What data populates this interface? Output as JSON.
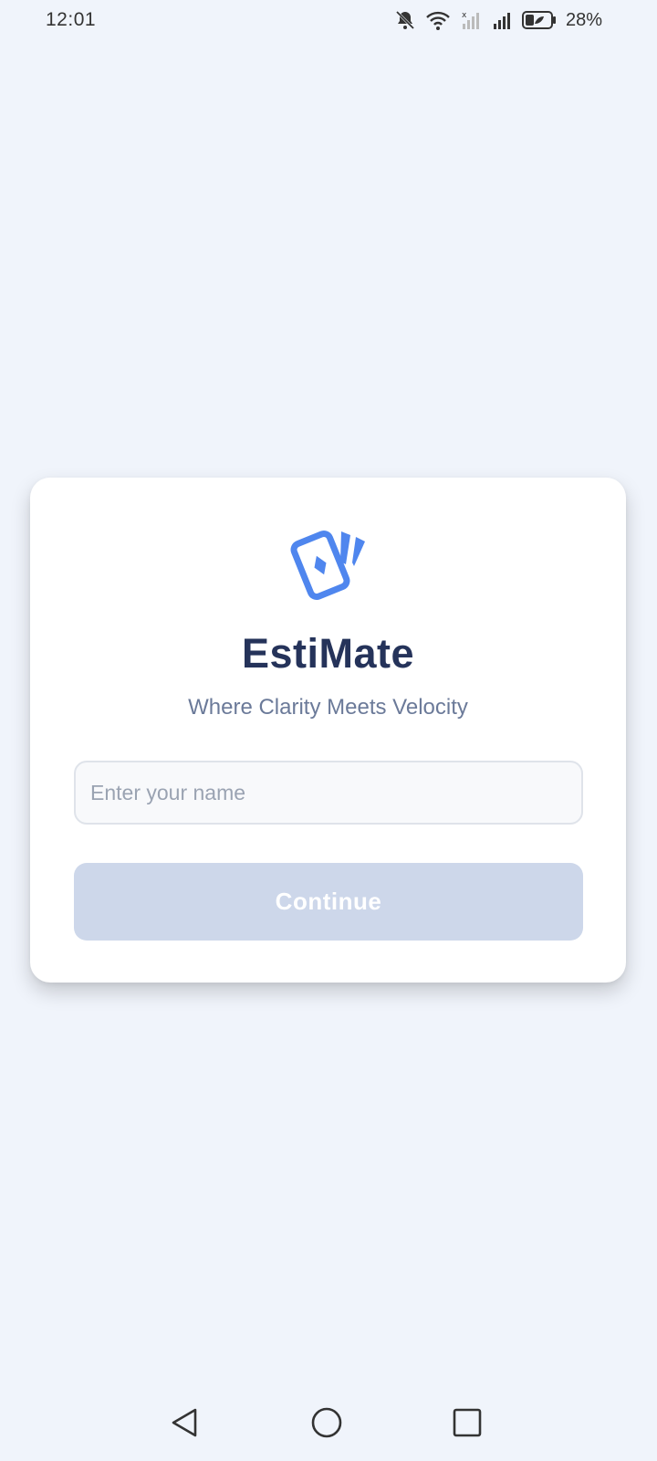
{
  "status_bar": {
    "time": "12:01",
    "battery_percent": "28%",
    "icons": [
      "bell-muted-icon",
      "wifi-icon",
      "signal-no-service-icon",
      "signal-icon",
      "battery-icon"
    ]
  },
  "card": {
    "logo_icon": "cards-icon",
    "title": "EstiMate",
    "tagline": "Where Clarity Meets Velocity",
    "name_input": {
      "placeholder": "Enter your name",
      "value": ""
    },
    "continue_label": "Continue",
    "continue_disabled": true
  },
  "nav_bar": {
    "icons": [
      "back-icon",
      "home-icon",
      "recents-icon"
    ]
  },
  "colors": {
    "background": "#f0f4fb",
    "brand_blue": "#4f86ee",
    "title": "#25335a",
    "tagline": "#6b7a99",
    "button_disabled": "#cdd7ea"
  }
}
